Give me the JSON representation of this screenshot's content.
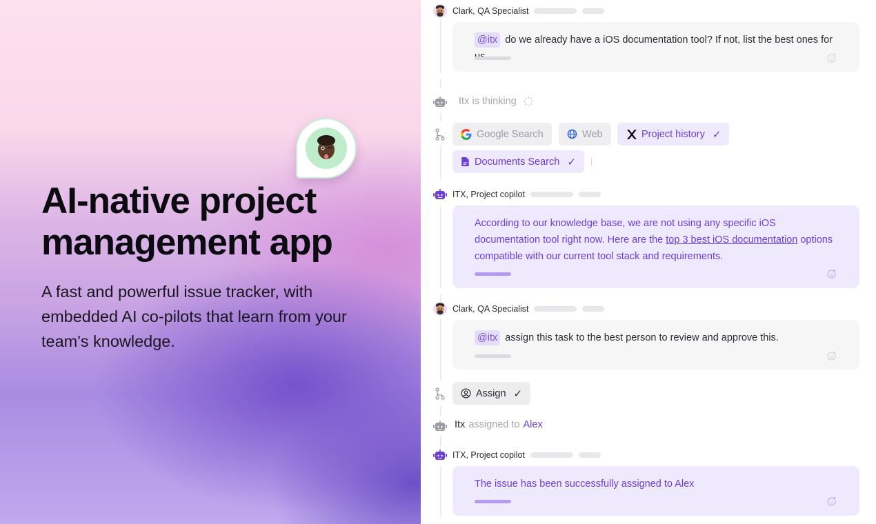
{
  "hero": {
    "title": "AI-native project management app",
    "subtitle": "A fast and powerful issue tracker, with embedded AI co-pilots that learn from your team's knowledge.",
    "avatar_pin": "memoji-avatar"
  },
  "colors": {
    "accent": "#6b3fd4",
    "accent_bg": "#efe9fd",
    "bubble_gray": "#f6f6f7",
    "muted": "#a7a7ad",
    "pin_ring": "#bfeccb"
  },
  "chat": {
    "messages": [
      {
        "author": "Clark, QA Specialist",
        "mention": "@itx",
        "text": "do we already have a iOS documentation tool? If not, list the best ones for us."
      },
      {
        "author": "ITX, Project copilot",
        "text_before": "According to our knowledge base, we are not using any specific iOS documentation  tool right now. Here are the ",
        "link": "top 3 best iOS documentation",
        "text_after": " options compatible with our current tool stack and requirements."
      },
      {
        "author": "Clark, QA Specialist",
        "mention": "@itx",
        "text": "assign this task to the best person to review and approve this."
      },
      {
        "author": "ITX, Project copilot",
        "text": "The issue has been successfully assigned to Alex"
      }
    ],
    "thinking": {
      "label": "Itx is thinking"
    },
    "sources": [
      {
        "label": "Google Search",
        "icon": "google-icon",
        "active": false
      },
      {
        "label": "Web",
        "icon": "globe-icon",
        "active": false
      },
      {
        "label": "Project history",
        "icon": "x-logo-icon",
        "active": true,
        "check": "✓"
      },
      {
        "label": "Documents Search",
        "icon": "document-icon",
        "active": true,
        "check": "✓"
      }
    ],
    "action": {
      "label": "Assign",
      "icon": "user-circle-icon",
      "check": "✓"
    },
    "assignment": {
      "actor": "Itx",
      "verb": "assigned to",
      "assignee": "Alex"
    }
  }
}
